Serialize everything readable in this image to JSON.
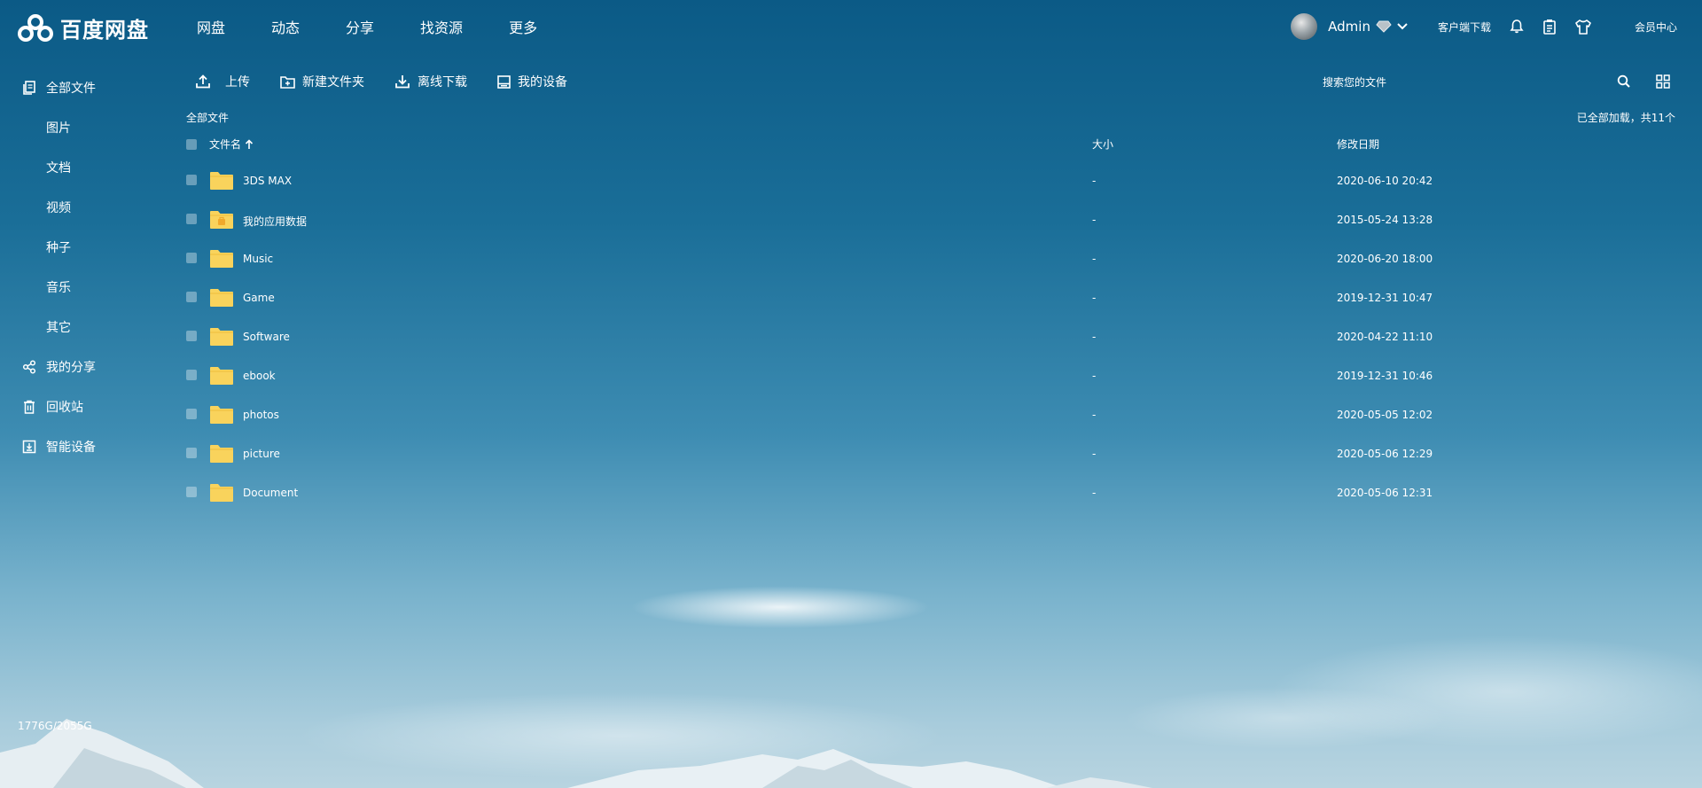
{
  "header": {
    "logo_text": "百度网盘",
    "nav": [
      "网盘",
      "动态",
      "分享",
      "找资源",
      "更多"
    ],
    "username": "Admin",
    "client_download": "客户端下载",
    "member_center": "会员中心"
  },
  "sidebar": {
    "all_files": "全部文件",
    "categories": [
      "图片",
      "文档",
      "视频",
      "种子",
      "音乐",
      "其它"
    ],
    "my_share": "我的分享",
    "recycle_bin": "回收站",
    "smart_device": "智能设备",
    "storage": "1776G/2055G"
  },
  "toolbar": {
    "upload": "上传",
    "new_folder": "新建文件夹",
    "offline_download": "离线下载",
    "my_devices": "我的设备",
    "search_placeholder": "搜索您的文件"
  },
  "breadcrumb": "全部文件",
  "loaded_info": "已全部加载，共11个",
  "table": {
    "col_name": "文件名",
    "col_size": "大小",
    "col_date": "修改日期",
    "rows": [
      {
        "name": "3DS MAX",
        "size": "-",
        "date": "2020-06-10 20:42",
        "icon": "folder-icon"
      },
      {
        "name": "我的应用数据",
        "size": "-",
        "date": "2015-05-24 13:28",
        "icon": "app-data-folder-icon"
      },
      {
        "name": "Music",
        "size": "-",
        "date": "2020-06-20 18:00",
        "icon": "folder-icon"
      },
      {
        "name": "Game",
        "size": "-",
        "date": "2019-12-31 10:47",
        "icon": "folder-icon"
      },
      {
        "name": "Software",
        "size": "-",
        "date": "2020-04-22 11:10",
        "icon": "folder-icon"
      },
      {
        "name": "ebook",
        "size": "-",
        "date": "2019-12-31 10:46",
        "icon": "folder-icon"
      },
      {
        "name": "photos",
        "size": "-",
        "date": "2020-05-05 12:02",
        "icon": "folder-icon"
      },
      {
        "name": "picture",
        "size": "-",
        "date": "2020-05-06 12:29",
        "icon": "folder-icon"
      },
      {
        "name": "Document",
        "size": "-",
        "date": "2020-05-06 12:31",
        "icon": "folder-icon"
      }
    ]
  },
  "colors": {
    "folder": "#f9d35c",
    "folder_dark": "#f0bd3c",
    "sky_top": "#0b5a86",
    "sky_bottom": "#b8d4e0"
  }
}
